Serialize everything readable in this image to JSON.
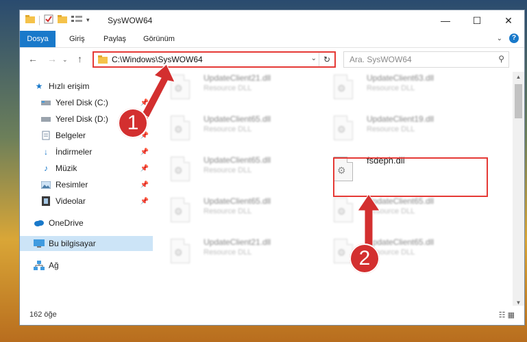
{
  "window": {
    "title": "SysWOW64",
    "controls": {
      "minimize": "—",
      "maximize": "☐",
      "close": "✕"
    }
  },
  "ribbon": {
    "tabs": [
      "Dosya",
      "Giriş",
      "Paylaş",
      "Görünüm"
    ],
    "active_tab": "Dosya",
    "help_label": "?"
  },
  "navigation": {
    "address": "C:\\Windows\\SysWOW64",
    "search_placeholder": "Ara. SysWOW64"
  },
  "sidebar": {
    "items": [
      {
        "label": "Hızlı erişim",
        "icon": "star-icon"
      },
      {
        "label": "Yerel Disk (C:)",
        "icon": "drive-icon"
      },
      {
        "label": "Yerel Disk (D:)",
        "icon": "drive-icon"
      },
      {
        "label": "Belgeler",
        "icon": "documents-icon"
      },
      {
        "label": "İndirmeler",
        "icon": "download-icon"
      },
      {
        "label": "Müzik",
        "icon": "music-icon"
      },
      {
        "label": "Resimler",
        "icon": "pictures-icon"
      },
      {
        "label": "Videolar",
        "icon": "videos-icon"
      },
      {
        "label": "OneDrive",
        "icon": "cloud-icon"
      },
      {
        "label": "Bu bilgisayar",
        "icon": "computer-icon"
      },
      {
        "label": "Ağ",
        "icon": "network-icon"
      }
    ]
  },
  "files": [
    {
      "name": "UpdateClient21.dll",
      "desc": "Resource DLL"
    },
    {
      "name": "UpdateClient63.dll",
      "desc": "Resource DLL"
    },
    {
      "name": "UpdateClient65.dll",
      "desc": "Resource DLL"
    },
    {
      "name": "UpdateClient19.dll",
      "desc": "Resource DLL"
    },
    {
      "name": "UpdateClient65.dll",
      "desc": "Resource DLL"
    },
    {
      "name": "fsdeph.dll",
      "desc": ""
    },
    {
      "name": "UpdateClient65.dll",
      "desc": "Resource DLL"
    },
    {
      "name": "UpdateClient65.dll",
      "desc": "Resource DLL"
    },
    {
      "name": "UpdateClient21.dll",
      "desc": "Resource DLL"
    },
    {
      "name": "UpdateClient65.dll",
      "desc": "Resource DLL"
    }
  ],
  "annotations": {
    "step1": "1",
    "step2": "2"
  },
  "status": {
    "count": "162 öğe"
  },
  "colors": {
    "accent": "#1979ca",
    "highlight": "#e53935",
    "badge": "#d32f2f"
  }
}
